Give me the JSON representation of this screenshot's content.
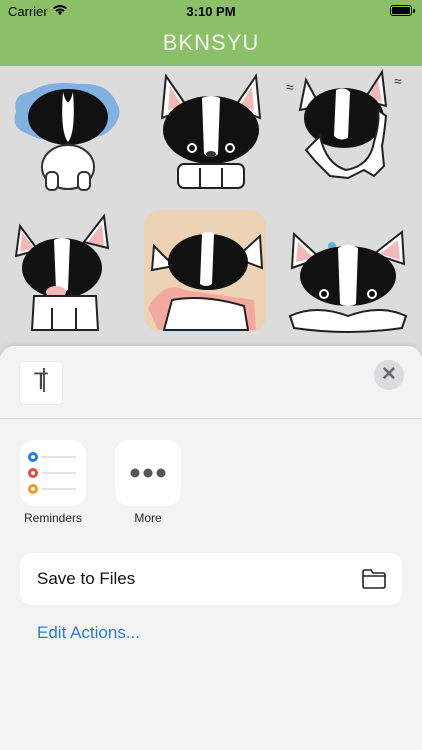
{
  "status_bar": {
    "carrier": "Carrier",
    "time": "3:10 PM"
  },
  "nav": {
    "title": "BKNSYU"
  },
  "stickers": [
    {
      "name": "dog-crying-sticker"
    },
    {
      "name": "dog-front-sticker"
    },
    {
      "name": "dog-walking-sticker"
    },
    {
      "name": "dog-sitting-sticker"
    },
    {
      "name": "dog-with-cat-sticker"
    },
    {
      "name": "dog-lying-sticker"
    }
  ],
  "share_sheet": {
    "preview_glyph": "T",
    "close_glyph": "✕",
    "apps": [
      {
        "label": "Reminders",
        "icon": "reminders-icon"
      },
      {
        "label": "More",
        "icon": "more-icon"
      }
    ],
    "actions": [
      {
        "label": "Save to Files",
        "icon": "folder-icon"
      }
    ],
    "edit_actions": "Edit Actions..."
  },
  "colors": {
    "nav": "#8cc068",
    "link": "#2b7bd6"
  }
}
